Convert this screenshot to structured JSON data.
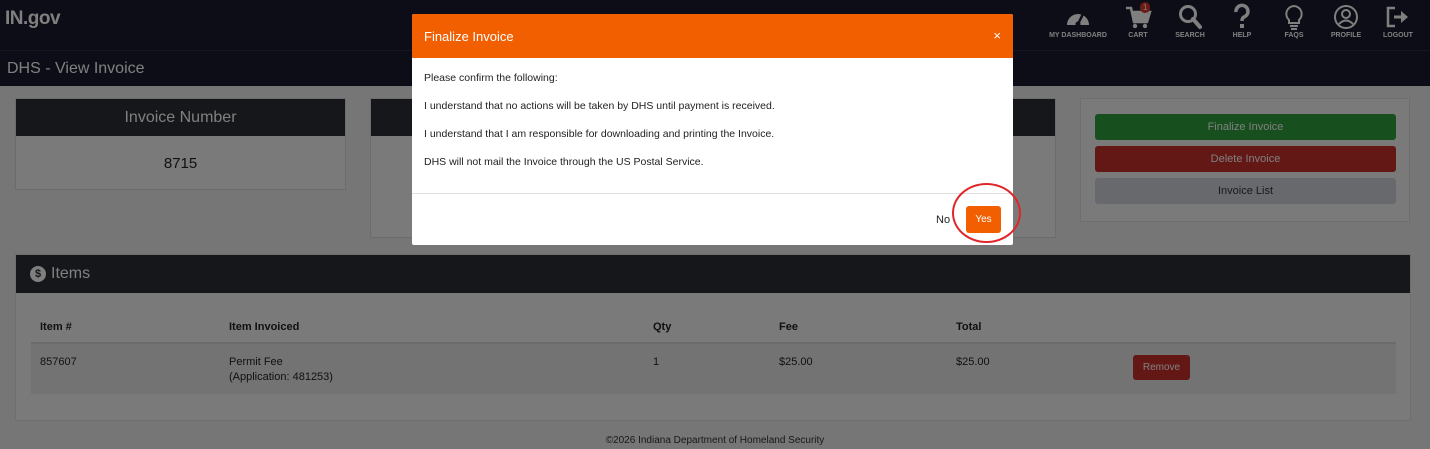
{
  "header": {
    "logo": "IN.gov",
    "nav": [
      {
        "label": "MY DASHBOARD",
        "icon": "dashboard-icon"
      },
      {
        "label": "CART",
        "icon": "cart-icon",
        "badge": "1"
      },
      {
        "label": "SEARCH",
        "icon": "search-icon"
      },
      {
        "label": "HELP",
        "icon": "help-icon"
      },
      {
        "label": "FAQS",
        "icon": "lightbulb-icon"
      },
      {
        "label": "PROFILE",
        "icon": "profile-icon"
      },
      {
        "label": "LOGOUT",
        "icon": "logout-icon"
      }
    ]
  },
  "page": {
    "title": "DHS - View Invoice"
  },
  "invoice_card": {
    "heading": "Invoice Number",
    "value": "8715"
  },
  "actions": {
    "finalize": "Finalize Invoice",
    "delete": "Delete Invoice",
    "list": "Invoice List"
  },
  "items": {
    "heading": "Items",
    "icon": "dollar-icon",
    "columns": [
      "Item #",
      "Item Invoiced",
      "Qty",
      "Fee",
      "Total"
    ],
    "rows": [
      {
        "item_no": "857607",
        "item_invoiced": "Permit Fee",
        "item_sub": "(Application: 481253)",
        "qty": "1",
        "fee": "$25.00",
        "total": "$25.00",
        "remove": "Remove"
      }
    ]
  },
  "footer": {
    "text": "©2026 Indiana Department of Homeland Security"
  },
  "modal": {
    "title": "Finalize Invoice",
    "close": "×",
    "lines": [
      "Please confirm the following:",
      "I understand that no actions will be taken by DHS until payment is received.",
      "I understand that I am responsible for downloading and printing the Invoice.",
      "DHS will not mail the Invoice through the US Postal Service."
    ],
    "no_label": "No",
    "yes_label": "Yes"
  },
  "colors": {
    "brand_dark": "#1b1a2e",
    "accent_orange": "#f15f00",
    "success_green": "#2e9e3f",
    "danger_red": "#c9302c",
    "highlight_ring": "#e0262a"
  }
}
